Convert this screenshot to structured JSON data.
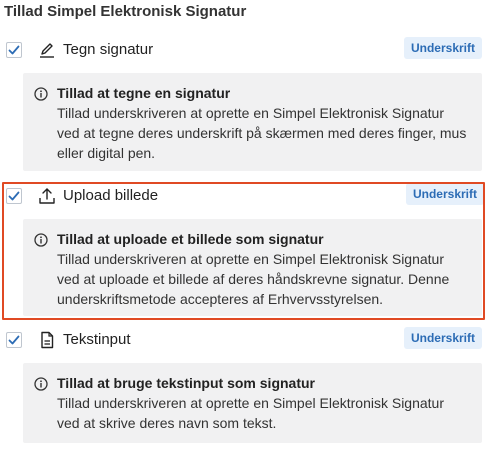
{
  "section_title": "Tillad Simpel Elektronisk Signatur",
  "options": [
    {
      "label": "Tegn signatur",
      "icon": "pen-icon",
      "checked": true,
      "badge": "Underskrift",
      "info_title": "Tillad at tegne en signatur",
      "info_body": "Tillad underskriveren at oprette en Simpel Elektronisk Signatur ved at tegne deres underskrift på skærmen med deres finger, mus eller digital pen."
    },
    {
      "label": "Upload billede",
      "icon": "upload-icon",
      "checked": true,
      "badge": "Underskrift",
      "highlighted": true,
      "info_title": "Tillad at uploade et billede som signatur",
      "info_body": "Tillad underskriveren at oprette en Simpel Elektronisk Signatur ved at uploade et billede af deres håndskrevne signatur. Denne underskriftsmetode accepteres af Erhvervsstyrelsen."
    },
    {
      "label": "Tekstinput",
      "icon": "document-icon",
      "checked": true,
      "badge": "Underskrift",
      "info_title": "Tillad at bruge tekstinput som signatur",
      "info_body": "Tillad underskriveren at oprette en Simpel Elektronisk Signatur ved at skrive deres navn som tekst."
    }
  ],
  "colors": {
    "checkmark": "#2c6cb5",
    "badge_bg": "#e6f0fb",
    "badge_text": "#2c6cb5",
    "info_bg": "#f1f1f2",
    "highlight_border": "#e04a24"
  }
}
